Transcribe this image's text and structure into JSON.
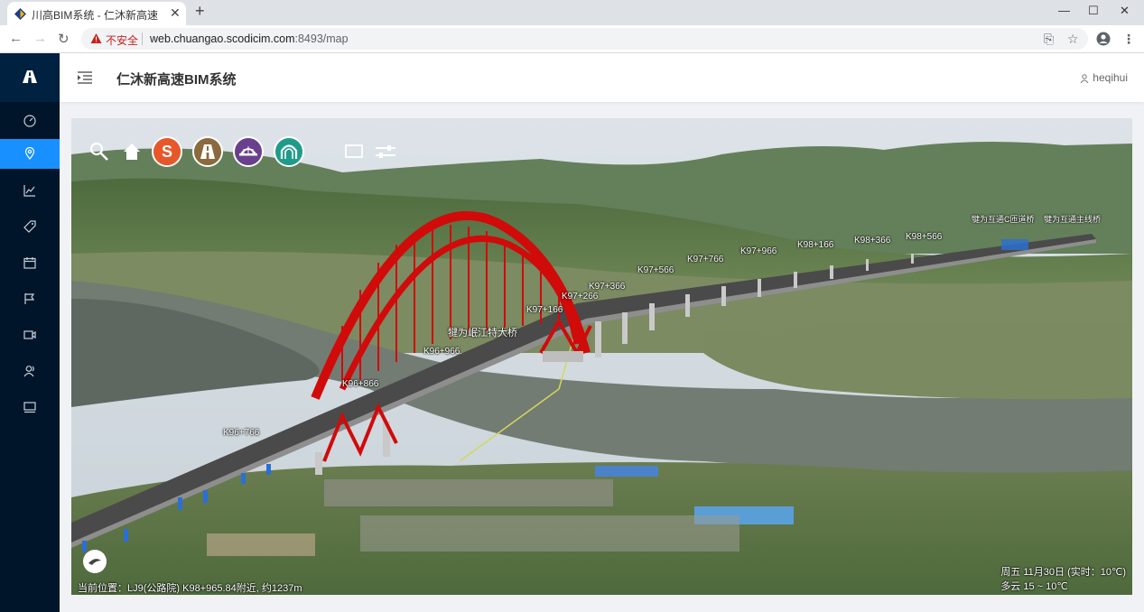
{
  "browser": {
    "tab_title": "川高BIM系统 - 仁沐新高速",
    "new_tab_label": "+",
    "security_label": "不安全",
    "url_host": "web.chuangao.scodicim.com",
    "url_rest": ":8493/map"
  },
  "header": {
    "title": "仁沐新高速BIM系统",
    "username": "heqihui"
  },
  "sidebar": {
    "items": [
      {
        "icon": "dashboard-icon"
      },
      {
        "icon": "map-pin-icon",
        "active": true
      },
      {
        "icon": "line-chart-icon"
      },
      {
        "icon": "tag-icon"
      },
      {
        "icon": "calendar-icon"
      },
      {
        "icon": "flag-icon"
      },
      {
        "icon": "video-icon"
      },
      {
        "icon": "users-icon"
      },
      {
        "icon": "monitor-icon"
      }
    ]
  },
  "map": {
    "tools": [
      {
        "icon": "search-icon"
      },
      {
        "icon": "home-icon"
      },
      {
        "icon": "s-badge-icon",
        "color": "#e8572a",
        "label": "S"
      },
      {
        "icon": "road-icon",
        "color": "#8a6a3e"
      },
      {
        "icon": "bridge-icon",
        "color": "#6a3f8e"
      },
      {
        "icon": "tunnel-icon",
        "color": "#1f9b8a"
      },
      {
        "icon": "layers-icon"
      },
      {
        "icon": "sliders-icon"
      }
    ],
    "stations": {
      "k96_766": "K96+766",
      "k96_866": "K96+866",
      "k96_966": "K96+966",
      "k97_166": "K97+166",
      "k97_266": "K97+266",
      "k97_366": "K97+366",
      "k97_566": "K97+566",
      "k97_766": "K97+766",
      "k97_966": "K97+966",
      "k98_166": "K98+166",
      "k98_366": "K98+366",
      "k98_566": "K98+566"
    },
    "labels": {
      "bridge_main": "犍为岷江特大桥",
      "bridge_c": "犍为互通C匝道桥",
      "bridge_main_line": "犍为互通主线桥"
    },
    "current_position": "当前位置：LJ9(公路院) K98+965.84附近, 约1237m",
    "weather_line1": "周五 11月30日 (实时：10℃)",
    "weather_line2": "多云  15 ~ 10℃"
  }
}
